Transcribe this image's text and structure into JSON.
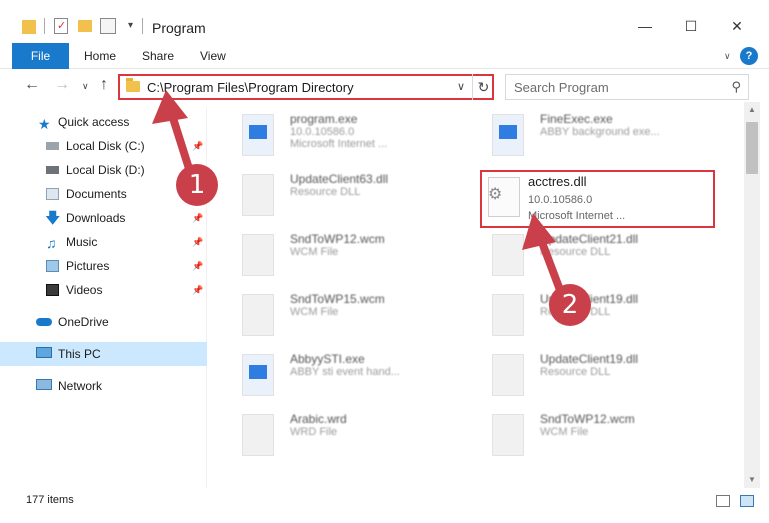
{
  "window": {
    "title": "Program",
    "minimize": "—",
    "maximize": "☐",
    "close": "✕"
  },
  "ribbon": {
    "tabs": [
      "File",
      "Home",
      "Share",
      "View"
    ],
    "help": "?"
  },
  "address": {
    "path": "C:\\Program Files\\Program Directory",
    "dropdown": "∨",
    "refresh": "↻"
  },
  "search": {
    "placeholder": "Search Program"
  },
  "sidebar": {
    "items": [
      {
        "label": "Quick access",
        "icon": "star-icon",
        "pinned": false
      },
      {
        "label": "Local Disk (C:)",
        "icon": "drive-icon",
        "pinned": true
      },
      {
        "label": "Local Disk (D:)",
        "icon": "drive-icon",
        "pinned": true
      },
      {
        "label": "Documents",
        "icon": "documents-icon",
        "pinned": true
      },
      {
        "label": "Downloads",
        "icon": "download-icon",
        "pinned": true
      },
      {
        "label": "Music",
        "icon": "music-icon",
        "pinned": true
      },
      {
        "label": "Pictures",
        "icon": "pictures-icon",
        "pinned": true
      },
      {
        "label": "Videos",
        "icon": "videos-icon",
        "pinned": true
      },
      {
        "label": "OneDrive",
        "icon": "cloud-icon",
        "pinned": false
      },
      {
        "label": "This PC",
        "icon": "computer-icon",
        "pinned": false,
        "selected": true
      },
      {
        "label": "Network",
        "icon": "network-icon",
        "pinned": false
      }
    ]
  },
  "files": [
    {
      "name": "program.exe",
      "line1": "10.0.10586.0",
      "line2": "Microsoft Internet ...",
      "kind": "app"
    },
    {
      "name": "FineExec.exe",
      "line1": "ABBY background exe...",
      "line2": "",
      "kind": "app"
    },
    {
      "name": "UpdateClient63.dll",
      "line1": "Resource DLL",
      "line2": "",
      "kind": "dll"
    },
    {
      "name": "SndToWP12.wcm",
      "line1": "WCM File",
      "line2": "",
      "kind": "doc"
    },
    {
      "name": "UpdateClient21.dll",
      "line1": "Resource DLL",
      "line2": "",
      "kind": "dll"
    },
    {
      "name": "SndToWP15.wcm",
      "line1": "WCM File",
      "line2": "",
      "kind": "doc"
    },
    {
      "name": "UpdateClient19.dll",
      "line1": "Resource DLL",
      "line2": "",
      "kind": "dll"
    },
    {
      "name": "AbbyySTI.exe",
      "line1": "ABBY sti event hand...",
      "line2": "",
      "kind": "app"
    },
    {
      "name": "UpdateClient19.dll",
      "line1": "Resource DLL",
      "line2": "",
      "kind": "dll"
    },
    {
      "name": "Arabic.wrd",
      "line1": "WRD File",
      "line2": "",
      "kind": "doc"
    },
    {
      "name": "SndToWP12.wcm",
      "line1": "WCM File",
      "line2": "",
      "kind": "doc"
    }
  ],
  "highlighted_file": {
    "name": "acctres.dll",
    "line1": "10.0.10586.0",
    "line2": "Microsoft Internet ..."
  },
  "status": {
    "item_count": "177 items"
  },
  "annotations": {
    "badge1": "1",
    "badge2": "2",
    "color": "#c9404a"
  }
}
